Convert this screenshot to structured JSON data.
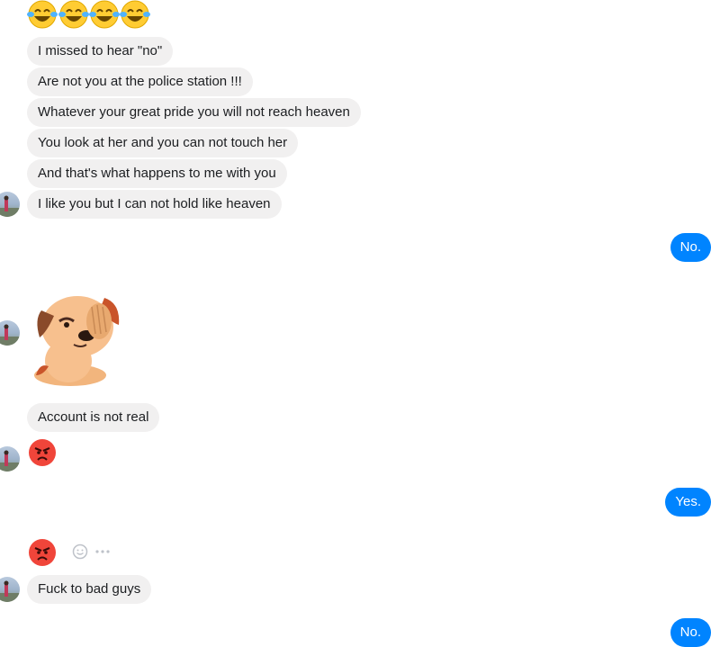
{
  "top_emoji_row": {
    "icon": "tears-of-joy-emoji",
    "count": 4
  },
  "messages_a": [
    "I missed to hear \"no\"",
    "Are not you at the police station !!!",
    "Whatever your great pride you will not reach heaven",
    "You look at her and you can not touch her",
    "And that's what happens to me with you",
    "I like you but I can not hold like heaven"
  ],
  "reply_1": "No.",
  "sticker": "puppy-facepalm-sticker",
  "message_account": "Account is not real",
  "angry_emoji_1": "angry-face-emoji",
  "reply_2": "Yes.",
  "angry_emoji_2": "angry-face-emoji",
  "actions": {
    "react_icon": "smiley-icon",
    "more_icon": "more-dots-icon"
  },
  "message_last": "Fuck to bad guys",
  "reply_3": "No.",
  "colors": {
    "incoming_bubble": "#f1f0f0",
    "outgoing_bubble": "#0084ff",
    "text": "#1c1e21"
  }
}
